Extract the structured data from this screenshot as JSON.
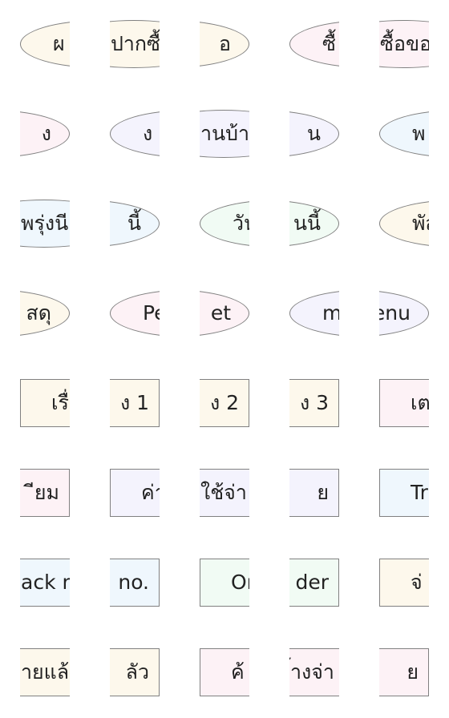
{
  "colors": {
    "cream": "#fdf8ec",
    "pink": "#fdf2f6",
    "lavender": "#f4f3fd",
    "blue": "#eff7fd",
    "mint": "#f1fbf4",
    "border": "#808080",
    "text": "#222222"
  },
  "rows": [
    {
      "shape": "ellipse",
      "tiles": [
        {
          "text": "ผ",
          "part": "left",
          "color": "cream"
        },
        {
          "text": "ปากซื้",
          "part": "middle",
          "color": "cream"
        },
        {
          "text": "อ",
          "part": "right",
          "color": "cream"
        },
        {
          "text": "ซื้",
          "part": "left",
          "color": "pink"
        },
        {
          "text": "ซื้อขอ",
          "part": "middle",
          "color": "pink"
        }
      ]
    },
    {
      "shape": "ellipse",
      "tiles": [
        {
          "text": "ง",
          "part": "right",
          "color": "pink"
        },
        {
          "text": "ง",
          "part": "left",
          "color": "lavender"
        },
        {
          "text": "านบ้า",
          "part": "middle",
          "color": "lavender"
        },
        {
          "text": "น",
          "part": "right",
          "color": "lavender"
        },
        {
          "text": "พ",
          "part": "left",
          "color": "blue"
        }
      ]
    },
    {
      "shape": "ellipse",
      "tiles": [
        {
          "text": "พรุ่งนี",
          "part": "middle",
          "color": "blue"
        },
        {
          "text": "นี้",
          "part": "right",
          "color": "blue"
        },
        {
          "text": "วัน",
          "part": "left",
          "color": "mint"
        },
        {
          "text": "นนี้",
          "part": "right",
          "color": "mint"
        },
        {
          "text": "พัส",
          "part": "left",
          "color": "cream"
        }
      ]
    },
    {
      "shape": "ellipse",
      "tiles": [
        {
          "text": "สดุ",
          "part": "right",
          "color": "cream"
        },
        {
          "text": "Pe",
          "part": "left",
          "color": "pink"
        },
        {
          "text": "et",
          "part": "right",
          "color": "pink"
        },
        {
          "text": "me",
          "part": "left",
          "color": "lavender"
        },
        {
          "text": "enu",
          "part": "right",
          "color": "lavender"
        }
      ]
    },
    {
      "shape": "rect",
      "tiles": [
        {
          "text": "เรื่อ",
          "part": "left",
          "color": "cream"
        },
        {
          "text": "ง 1",
          "part": "right",
          "color": "cream"
        },
        {
          "text": "ง 2",
          "part": "right",
          "color": "cream"
        },
        {
          "text": "ง 3",
          "part": "right",
          "color": "cream"
        },
        {
          "text": "เตรี",
          "part": "left",
          "color": "pink"
        }
      ]
    },
    {
      "shape": "rect",
      "tiles": [
        {
          "text": "ียม",
          "part": "right",
          "color": "pink"
        },
        {
          "text": "ค่า",
          "part": "left",
          "color": "lavender"
        },
        {
          "text": "ใช้จ่า",
          "part": "middle",
          "color": "lavender"
        },
        {
          "text": "ย",
          "part": "right",
          "color": "lavender"
        },
        {
          "text": "Tra",
          "part": "left",
          "color": "blue"
        }
      ]
    },
    {
      "shape": "rect",
      "tiles": [
        {
          "text": "ack n",
          "part": "middle",
          "color": "blue"
        },
        {
          "text": "no.",
          "part": "right",
          "color": "blue"
        },
        {
          "text": "Ord",
          "part": "left",
          "color": "mint"
        },
        {
          "text": "der",
          "part": "right",
          "color": "mint"
        },
        {
          "text": "จ่",
          "part": "left",
          "color": "cream"
        }
      ]
    },
    {
      "shape": "rect",
      "tiles": [
        {
          "text": "ายแล้",
          "part": "middle",
          "color": "cream"
        },
        {
          "text": "ลัว",
          "part": "right",
          "color": "cream"
        },
        {
          "text": "ค้",
          "part": "left",
          "color": "pink"
        },
        {
          "text": "้างจ่า",
          "part": "middle",
          "color": "pink"
        },
        {
          "text": "ย",
          "part": "right",
          "color": "pink"
        }
      ]
    }
  ]
}
